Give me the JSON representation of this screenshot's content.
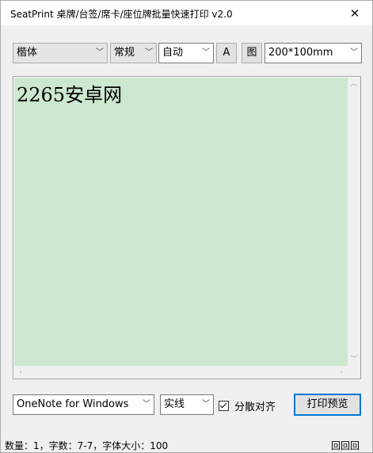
{
  "window": {
    "title": "SeatPrint 桌牌/台签/席卡/座位牌批量快速打印 v2.0",
    "close_glyph": "✕"
  },
  "toolbar": {
    "font_family": "楷体",
    "font_style": "常规",
    "size_mode": "自动",
    "text_button": "A",
    "image_button": "图",
    "paper_size": "200*100mm"
  },
  "editor": {
    "text": "2265安卓网",
    "background_color": "#cde8d1"
  },
  "bottom": {
    "printer": "OneNote for Windows",
    "line_style": "实线",
    "distribute_label": "分散对齐",
    "distribute_checked": true,
    "preview_button": "打印预览"
  },
  "status": {
    "info": "数量：1，字数：7-7，字体大小：100",
    "right": "回回回"
  },
  "icons": {
    "dropdown": "chevron-down-icon",
    "close": "close-icon",
    "scroll_up": "scroll-up-icon",
    "scroll_down": "scroll-down-icon",
    "scroll_left": "scroll-left-icon",
    "scroll_right": "scroll-right-icon"
  }
}
